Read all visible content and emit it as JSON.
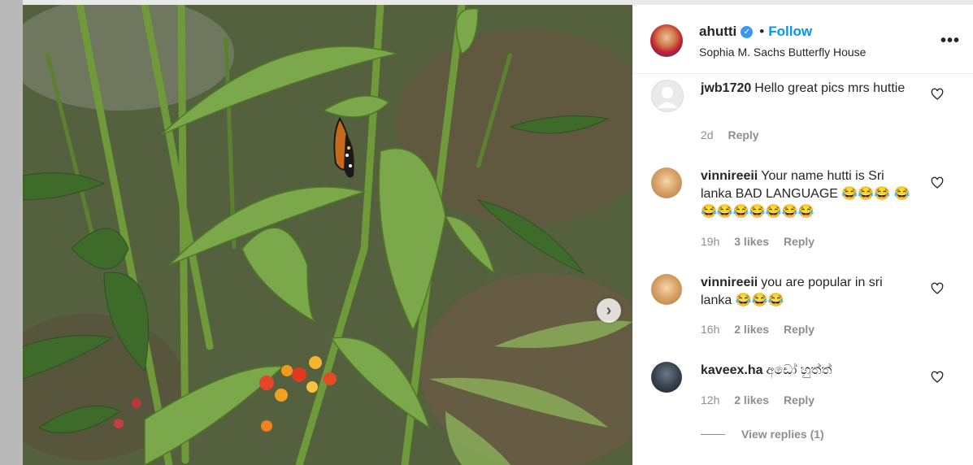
{
  "post": {
    "username": "ahutti",
    "follow_label": "Follow",
    "dot": "•",
    "location": "Sophia M. Sachs Butterfly House",
    "more_icon": "more-horizontal-icon",
    "more_glyph": "•••"
  },
  "photo": {
    "next_glyph": "›"
  },
  "comments": [
    {
      "user": "jwb1720",
      "text": "Hello great pics mrs huttie",
      "time": "2d",
      "likes": "",
      "reply": "Reply"
    },
    {
      "user": "vinnireeii",
      "text": "Your name hutti is Sri lanka BAD LANGUAGE 😂😂😂 😂😂😂😂😂😂😂😂",
      "time": "19h",
      "likes": "3 likes",
      "reply": "Reply"
    },
    {
      "user": "vinnireeii",
      "text": "you are popular in sri lanka 😂😂😂",
      "time": "16h",
      "likes": "2 likes",
      "reply": "Reply"
    },
    {
      "user": "kaveex.ha",
      "text": "අඩෝ හුත්ත්",
      "time": "12h",
      "likes": "2 likes",
      "reply": "Reply"
    }
  ],
  "view_replies": "View replies (1)",
  "colors": {
    "accent": "#0095f6",
    "verified": "#3897f0",
    "meta_gray": "#8e8e8e"
  }
}
